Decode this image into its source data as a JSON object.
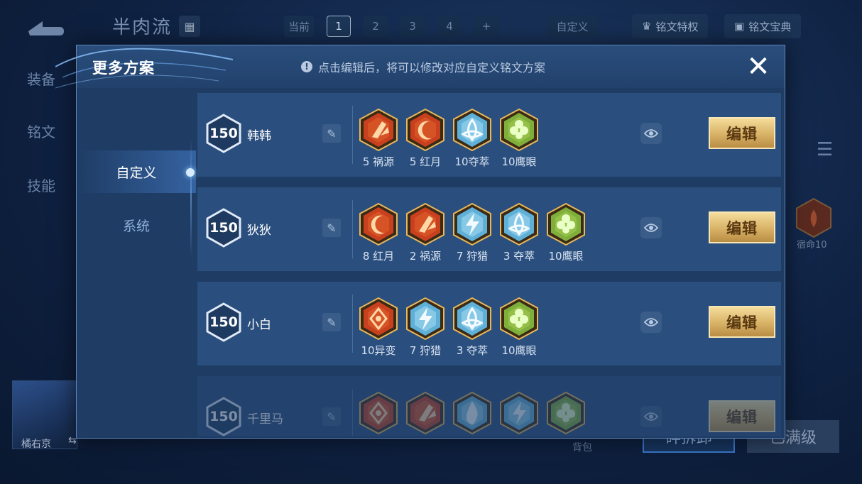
{
  "background": {
    "hero_title": "半肉流",
    "page_tabs": [
      {
        "label": "当前",
        "active": false
      },
      {
        "label": "1",
        "active": true
      },
      {
        "label": "2",
        "active": false
      },
      {
        "label": "3",
        "active": false
      },
      {
        "label": "4",
        "active": false
      },
      {
        "label": "+",
        "active": false
      }
    ],
    "custom_tab": "自定义",
    "privilege_button": "铭文特权",
    "codex_button": "铭文宝典",
    "side_nav": [
      "装备",
      "铭文",
      "技能"
    ],
    "bg_rune_label": "宿命10",
    "player_name": "橘右京",
    "swap_symbol": "⇆",
    "bag_label": "背包",
    "bottom_btn_blue": "碎拆卸",
    "bottom_btn_max": "已满级"
  },
  "modal": {
    "title": "更多方案",
    "hint": "点击编辑后，将可以修改对应自定义铭文方案",
    "close_symbol": "✕",
    "tabs": [
      {
        "label": "自定义",
        "active": true
      },
      {
        "label": "系统",
        "active": false
      }
    ],
    "plans": [
      {
        "level": "150",
        "name": "韩韩",
        "edit_label": "编辑",
        "faded": false,
        "runes": [
          {
            "label": "5 祸源",
            "color": "red",
            "icon": "broken-blade-icon"
          },
          {
            "label": "5 红月",
            "color": "red",
            "icon": "crescent-moon-icon"
          },
          {
            "label": "10夺萃",
            "color": "blue",
            "icon": "triquetra-icon"
          },
          {
            "label": "10鹰眼",
            "color": "green",
            "icon": "clover-icon"
          }
        ]
      },
      {
        "level": "150",
        "name": "狄狄",
        "edit_label": "编辑",
        "faded": false,
        "runes": [
          {
            "label": "8 红月",
            "color": "red",
            "icon": "crescent-moon-icon"
          },
          {
            "label": "2 祸源",
            "color": "red",
            "icon": "broken-blade-icon"
          },
          {
            "label": "7 狩猎",
            "color": "blue",
            "icon": "lightning-icon"
          },
          {
            "label": "3 夺萃",
            "color": "blue",
            "icon": "triquetra-icon"
          },
          {
            "label": "10鹰眼",
            "color": "green",
            "icon": "clover-icon"
          }
        ]
      },
      {
        "level": "150",
        "name": "小白",
        "edit_label": "编辑",
        "faded": false,
        "runes": [
          {
            "label": "10异变",
            "color": "red",
            "icon": "mutation-icon"
          },
          {
            "label": "7 狩猎",
            "color": "blue",
            "icon": "lightning-icon"
          },
          {
            "label": "3 夺萃",
            "color": "blue",
            "icon": "triquetra-icon"
          },
          {
            "label": "10鹰眼",
            "color": "green",
            "icon": "clover-icon"
          }
        ]
      },
      {
        "level": "150",
        "name": "千里马",
        "edit_label": "编辑",
        "faded": true,
        "runes": [
          {
            "label": "",
            "color": "red",
            "icon": "mutation-icon"
          },
          {
            "label": "",
            "color": "red",
            "icon": "broken-blade-icon"
          },
          {
            "label": "",
            "color": "blue",
            "icon": "flame-icon"
          },
          {
            "label": "",
            "color": "blue",
            "icon": "lightning-icon"
          },
          {
            "label": "",
            "color": "green",
            "icon": "clover-icon"
          }
        ]
      }
    ]
  },
  "colors": {
    "red_fill": "#c8401e",
    "blue_fill": "#5fb0d8",
    "green_fill": "#7fae3a",
    "gold_frame": "#e7b85c",
    "edit_button": "#d8b266"
  }
}
